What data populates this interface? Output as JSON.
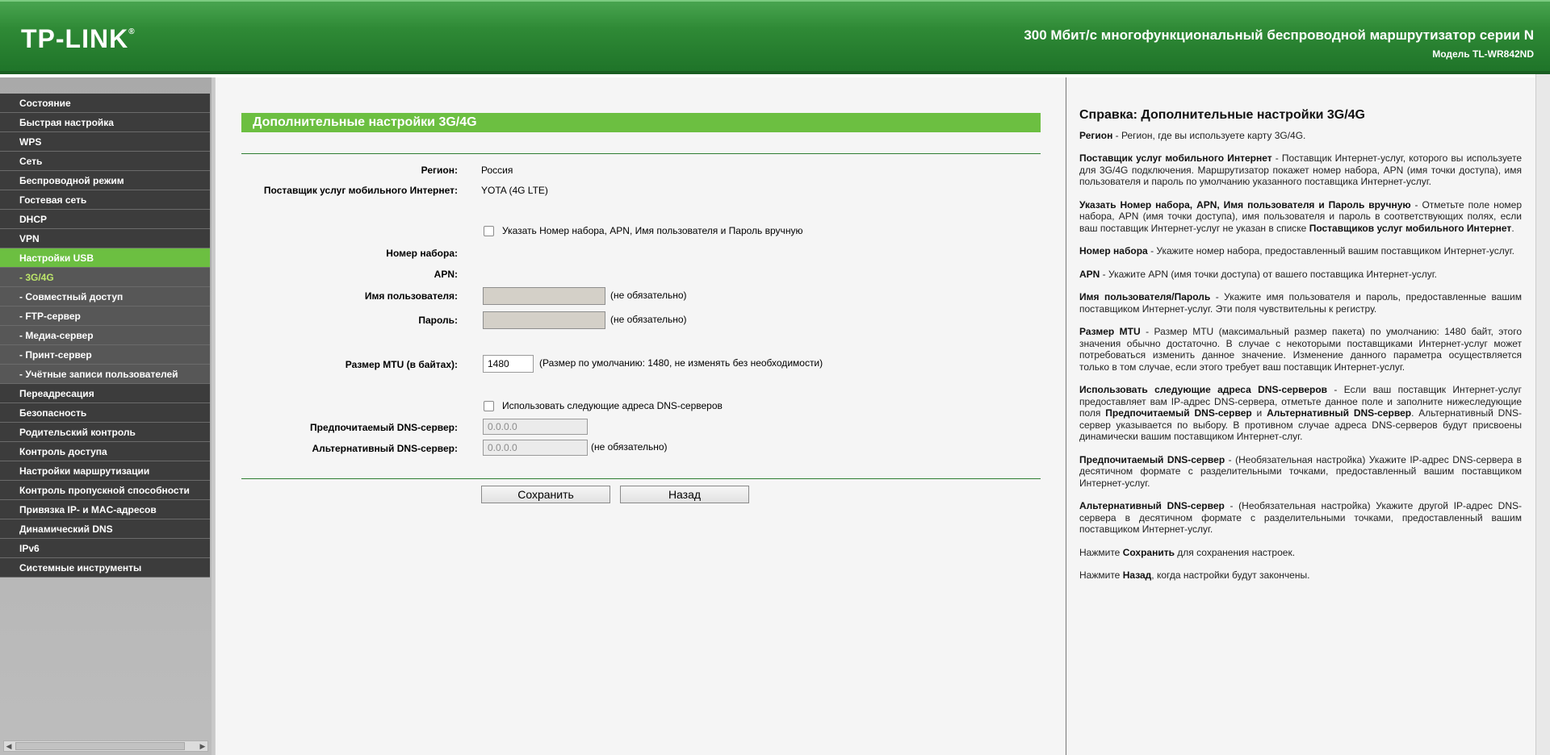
{
  "header": {
    "logo": "TP-LINK",
    "logo_mark": "®",
    "title": "300 Мбит/с многофункциональный беспроводной маршрутизатор серии N",
    "model": "Модель TL-WR842ND"
  },
  "menu": [
    {
      "label": "Состояние"
    },
    {
      "label": "Быстрая настройка"
    },
    {
      "label": "WPS"
    },
    {
      "label": "Сеть"
    },
    {
      "label": "Беспроводной режим"
    },
    {
      "label": "Гостевая сеть"
    },
    {
      "label": "DHCP"
    },
    {
      "label": "VPN"
    },
    {
      "label": "Настройки USB"
    },
    {
      "label": "- 3G/4G"
    },
    {
      "label": "- Совместный доступ"
    },
    {
      "label": "- FTP-сервер"
    },
    {
      "label": "- Медиа-сервер"
    },
    {
      "label": "- Принт-сервер"
    },
    {
      "label": "- Учётные записи пользователей"
    },
    {
      "label": "Переадресация"
    },
    {
      "label": "Безопасность"
    },
    {
      "label": "Родительский контроль"
    },
    {
      "label": "Контроль доступа"
    },
    {
      "label": "Настройки маршрутизации"
    },
    {
      "label": "Контроль пропускной способности"
    },
    {
      "label": "Привязка IP- и MAC-адресов"
    },
    {
      "label": "Динамический DNS"
    },
    {
      "label": "IPv6"
    },
    {
      "label": "Системные инструменты"
    }
  ],
  "form": {
    "title": "Дополнительные настройки 3G/4G",
    "region_label": "Регион:",
    "region_value": "Россия",
    "isp_label": "Поставщик услуг мобильного Интернет:",
    "isp_value": "YOTA (4G LTE)",
    "manual_checkbox_label": "Указать Номер набора, APN, Имя пользователя и Пароль вручную",
    "dial_label": "Номер набора:",
    "apn_label": "APN:",
    "username_label": "Имя пользователя:",
    "password_label": "Пароль:",
    "optional_note": "(не обязательно)",
    "mtu_label": "Размер MTU (в байтах):",
    "mtu_value": "1480",
    "mtu_note": "(Размер по умолчанию: 1480, не изменять без необходимости)",
    "dns_checkbox_label": "Использовать следующие адреса DNS-серверов",
    "primary_dns_label": "Предпочитаемый DNS-сервер:",
    "primary_dns_value": "0.0.0.0",
    "secondary_dns_label": "Альтернативный DNS-сервер:",
    "secondary_dns_value": "0.0.0.0",
    "save_label": "Сохранить",
    "back_label": "Назад"
  },
  "help": {
    "title": "Справка: Дополнительные настройки 3G/4G",
    "p1_b": "Регион",
    "p1": " - Регион, где вы используете карту 3G/4G.",
    "p2_b": "Поставщик услуг мобильного Интернет",
    "p2": " - Поставщик Интернет-услуг, которого вы используете для 3G/4G подключения. Маршрутизатор покажет номер набора, APN (имя точки доступа), имя пользователя и пароль по умолчанию указанного поставщика Интернет-услуг.",
    "p3_b": "Указать Номер набора, APN, Имя пользователя и Пароль вручную",
    "p3": " - Отметьте поле номер набора, APN (имя точки доступа), имя пользователя и пароль в соответствующих полях, если ваш поставщик Интернет-услуг не указан в списке ",
    "p3_b2": "Поставщиков услуг мобильного Интернет",
    "p3_end": ".",
    "p4_b": "Номер набора",
    "p4": " - Укажите номер набора, предоставленный вашим поставщиком Интернет-услуг.",
    "p5_b": "APN",
    "p5": " - Укажите APN (имя точки доступа) от вашего поставщика Интернет-услуг.",
    "p6_b": "Имя пользователя/Пароль",
    "p6": " - Укажите имя пользователя и пароль, предоставленные вашим поставщиком Интернет-услуг. Эти поля чувствительны к регистру.",
    "p7_b": "Размер MTU",
    "p7": " - Размер MTU (максимальный размер пакета) по умолчанию: 1480 байт, этого значения обычно достаточно. В случае с некоторыми поставщиками Интернет-услуг может потребоваться изменить данное значение. Изменение данного параметра осуществляется только в том случае, если этого требует ваш поставщик Интернет-услуг.",
    "p8_b": "Использовать следующие адреса DNS-серверов",
    "p8": " - Если ваш поставщик Интернет-услуг предоставляет вам IP-адрес DNS-сервера, отметьте данное поле и заполните нижеследующие поля ",
    "p8_b2": "Предпочитаемый DNS-сервер",
    "p8_mid": " и ",
    "p8_b3": "Альтернативный DNS-сервер",
    "p8_end": ". Альтернативный DNS-сервер указывается по выбору. В противном случае адреса DNS-серверов будут присвоены динамически вашим поставщиком Интернет-слуг.",
    "p9_b": "Предпочитаемый DNS-сервер",
    "p9": " - (Необязательная настройка) Укажите IP-адрес DNS-сервера в десятичном формате с разделительными точками, предоставленный вашим поставщиком Интернет-услуг.",
    "p10_b": "Альтернативный DNS-сервер",
    "p10": " - (Необязательная настройка) Укажите другой IP-адрес DNS-сервера в десятичном формате с разделительными точками, предоставленный вашим поставщиком Интернет-услуг.",
    "p11_pre": "Нажмите ",
    "p11_b": "Сохранить",
    "p11": " для сохранения настроек.",
    "p12_pre": "Нажмите ",
    "p12_b": "Назад",
    "p12": ", когда настройки будут закончены."
  }
}
